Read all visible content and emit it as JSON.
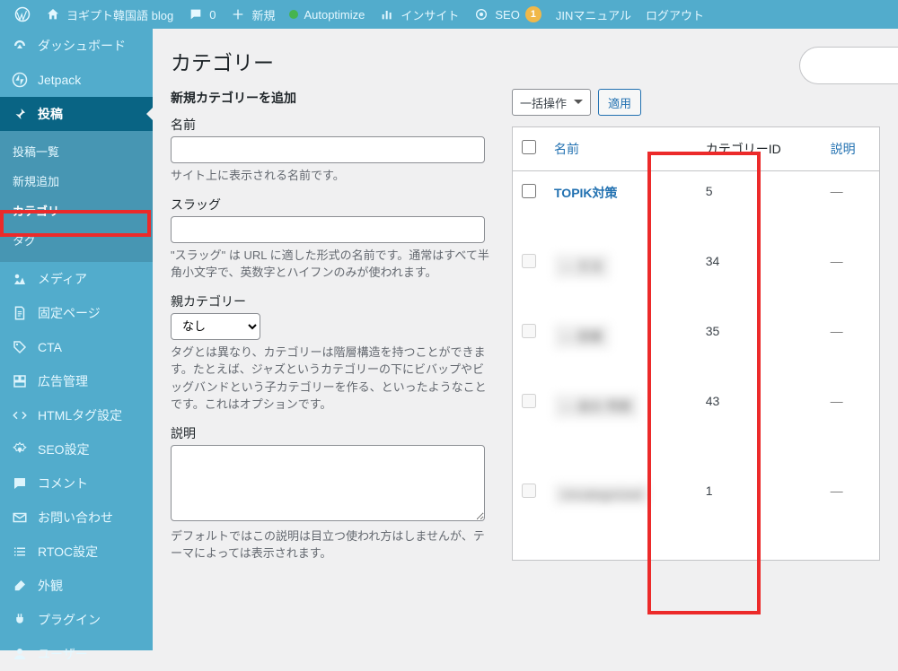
{
  "topbar": {
    "site_title": "ヨギプト韓国語 blog",
    "comment_count": "0",
    "new_label": "新規",
    "autoptimize": "Autoptimize",
    "insight": "インサイト",
    "seo_label": "SEO",
    "seo_badge": "1",
    "jin_manual": "JINマニュアル",
    "logout": "ログアウト"
  },
  "sidebar": {
    "dashboard": "ダッシュボード",
    "jetpack": "Jetpack",
    "posts": "投稿",
    "posts_sub": {
      "all": "投稿一覧",
      "new": "新規追加",
      "cat": "カテゴリー",
      "tag": "タグ"
    },
    "media": "メディア",
    "pages": "固定ページ",
    "cta": "CTA",
    "ads": "広告管理",
    "htmltag": "HTMLタグ設定",
    "seo": "SEO設定",
    "comments": "コメント",
    "contact": "お問い合わせ",
    "rtoc": "RTOC設定",
    "appearance": "外観",
    "plugins": "プラグイン",
    "users": "ユーザー"
  },
  "page": {
    "h1": "カテゴリー",
    "add_h2": "新規カテゴリーを追加",
    "name_label": "名前",
    "name_hint": "サイト上に表示される名前です。",
    "slug_label": "スラッグ",
    "slug_hint": "\"スラッグ\" は URL に適した形式の名前です。通常はすべて半角小文字で、英数字とハイフンのみが使われます。",
    "parent_label": "親カテゴリー",
    "parent_option": "なし",
    "parent_hint": "タグとは異なり、カテゴリーは階層構造を持つことができます。たとえば、ジャズというカテゴリーの下にビバップやビッグバンドという子カテゴリーを作る、といったようなことです。これはオプションです。",
    "desc_label": "説明",
    "desc_hint": "デフォルトではこの説明は目立つ使われ方はしませんが、テーマによっては表示されます。"
  },
  "bulk": {
    "label": "一括操作",
    "apply": "適用"
  },
  "table": {
    "cols": {
      "name": "名前",
      "catid": "カテゴリーID",
      "desc": "説明"
    },
    "rows": [
      {
        "name": "TOPIK対策",
        "id": "5",
        "desc": "—",
        "blur": false
      },
      {
        "name": "— 文法",
        "id": "34",
        "desc": "—",
        "blur": true
      },
      {
        "name": "— 語彙",
        "id": "35",
        "desc": "—",
        "blur": true
      },
      {
        "name": "— 過去\n問題",
        "id": "43",
        "desc": "—",
        "blur": true
      },
      {
        "name": "Uncategorized",
        "id": "1",
        "desc": "—",
        "blur": true
      }
    ]
  }
}
